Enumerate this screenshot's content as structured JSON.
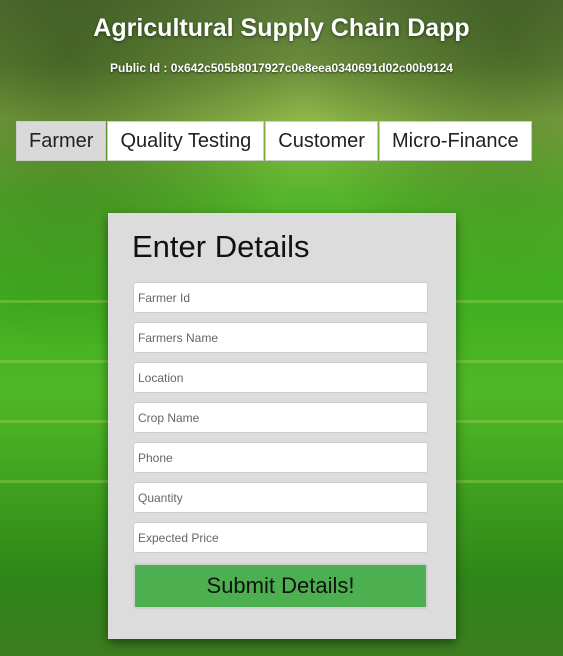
{
  "header": {
    "title": "Agricultural Supply Chain Dapp",
    "public_id": "Public Id : 0x642c505b8017927c0e8eea0340691d02c00b9124"
  },
  "tabs": [
    {
      "label": "Farmer",
      "active": true
    },
    {
      "label": "Quality Testing",
      "active": false
    },
    {
      "label": "Customer",
      "active": false
    },
    {
      "label": "Micro-Finance",
      "active": false
    }
  ],
  "form": {
    "title": "Enter Details",
    "fields": [
      {
        "placeholder": "Farmer Id",
        "value": ""
      },
      {
        "placeholder": "Farmers Name",
        "value": ""
      },
      {
        "placeholder": "Location",
        "value": ""
      },
      {
        "placeholder": "Crop Name",
        "value": ""
      },
      {
        "placeholder": "Phone",
        "value": ""
      },
      {
        "placeholder": "Quantity",
        "value": ""
      },
      {
        "placeholder": "Expected Price",
        "value": ""
      }
    ],
    "submit_label": "Submit Details!"
  },
  "colors": {
    "submit_button": "#4caf50",
    "card_background": "#dcdcdc",
    "active_tab": "#d9d9d9"
  }
}
